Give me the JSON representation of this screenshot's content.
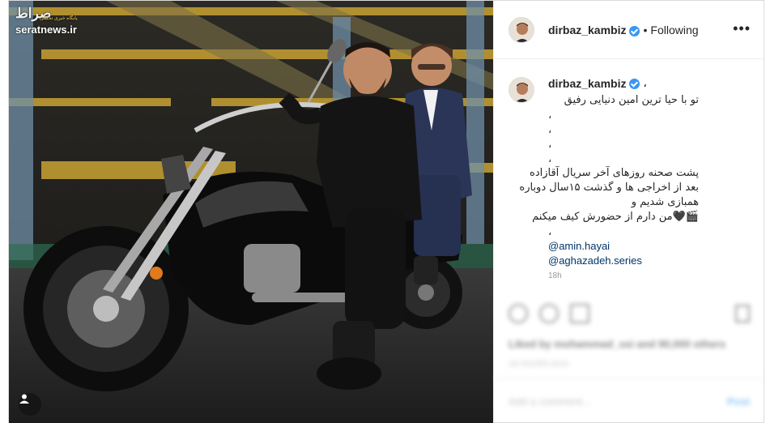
{
  "watermark": {
    "logo": "صراط",
    "sub": "پایگاه خبری تحلیلی",
    "url": "seratnews.ir"
  },
  "post": {
    "username": "dirbaz_kambiz",
    "verified": true,
    "follow_status": "Following",
    "more_icon": "more-horizontal-icon",
    "caption": {
      "username": "dirbaz_kambiz",
      "leading_comma": "،",
      "lines": [
        "تو با حیا ترین امین دنیایی رفیق",
        "،",
        "،",
        "،",
        "،",
        "پشت صحنه روزهای آخر سریال آقازاده",
        "بعد از اخراجی ها و گذشت ۱۵سال دوباره",
        "همبازی شدیم و",
        "🎬🖤من دارم از حضورش کیف میکنم",
        "،"
      ],
      "mentions": [
        "@amin.hayai",
        "@aghazadeh.series"
      ],
      "timestamp": "18h"
    },
    "actions": {
      "likes_text": "Liked by mohammad_ssi and 90,000 others",
      "posted_text": "18 HOURS AGO",
      "comment_placeholder": "Add a comment...",
      "post_label": "Post"
    }
  },
  "colors": {
    "accent": "#3897f0",
    "mention": "#003569",
    "text": "#262626"
  }
}
